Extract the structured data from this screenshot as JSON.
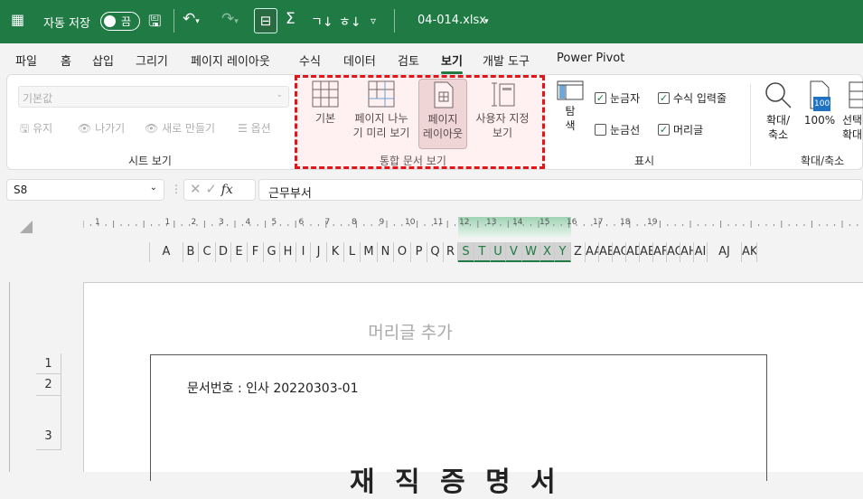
{
  "titlebar": {
    "autosave_label": "자동 저장",
    "toggle_state": "끔",
    "filename": "04-014.xlsx",
    "app_icon": "excel-icon"
  },
  "menu": {
    "tabs": [
      "파일",
      "홈",
      "삽입",
      "그리기",
      "페이지 레이아웃",
      "수식",
      "데이터",
      "검토",
      "보기",
      "개발 도구",
      "Power Pivot"
    ],
    "active": "보기"
  },
  "ribbon": {
    "sheet_view": {
      "dropdown_value": "기본값",
      "keep": "유지",
      "exit": "나가기",
      "new": "새로 만들기",
      "options": "옵션",
      "group_label": "시트 보기"
    },
    "workbook_views": {
      "normal": "기본",
      "page_break_1": "페이지 나누",
      "page_break_2": "기 미리 보기",
      "page_layout_1": "페이지",
      "page_layout_2": "레이아웃",
      "custom_1": "사용자 지정",
      "custom_2": "보기",
      "group_label": "통합 문서 보기"
    },
    "show": {
      "nav_1": "탐",
      "nav_2": "색",
      "ruler": "눈금자",
      "ruler_checked": true,
      "formula_bar": "수식 입력줄",
      "formula_bar_checked": true,
      "gridlines": "눈금선",
      "gridlines_checked": false,
      "headings": "머리글",
      "headings_checked": true,
      "group_label": "표시"
    },
    "zoom": {
      "zoom_1": "확대/",
      "zoom_2": "축소",
      "hundred": "100%",
      "hundred_badge": "100",
      "selection_1": "선택",
      "selection_2": "확대",
      "group_label": "확대/축소"
    }
  },
  "formula_bar": {
    "cell": "S8",
    "value": "근무부서"
  },
  "ruler_numbers": [
    "1",
    "1",
    "2",
    "3",
    "4",
    "5",
    "6",
    "7",
    "8",
    "9",
    "10",
    "11",
    "12",
    "13",
    "14",
    "15",
    "16",
    "17",
    "18",
    "19"
  ],
  "columns": [
    "A",
    "B",
    "C",
    "D",
    "E",
    "F",
    "G",
    "H",
    "I",
    "J",
    "K",
    "L",
    "M",
    "N",
    "O",
    "P",
    "Q",
    "R",
    "S",
    "T",
    "U",
    "V",
    "W",
    "X",
    "Y",
    "Z",
    "AA",
    "AB",
    "AC",
    "AD",
    "AE",
    "AF",
    "AG",
    "AH",
    "AI",
    "AJ",
    "AK"
  ],
  "selected_columns": [
    "S",
    "T",
    "U",
    "V",
    "W",
    "X",
    "Y"
  ],
  "rows": [
    "1",
    "2",
    "3"
  ],
  "page": {
    "header_placeholder": "머리글 추가",
    "doc_number": "문서번호 : 인사 20220303-01",
    "title": "재 직 증 명 서"
  },
  "colors": {
    "brand": "#1f7a44",
    "highlight": "#e0161b"
  }
}
